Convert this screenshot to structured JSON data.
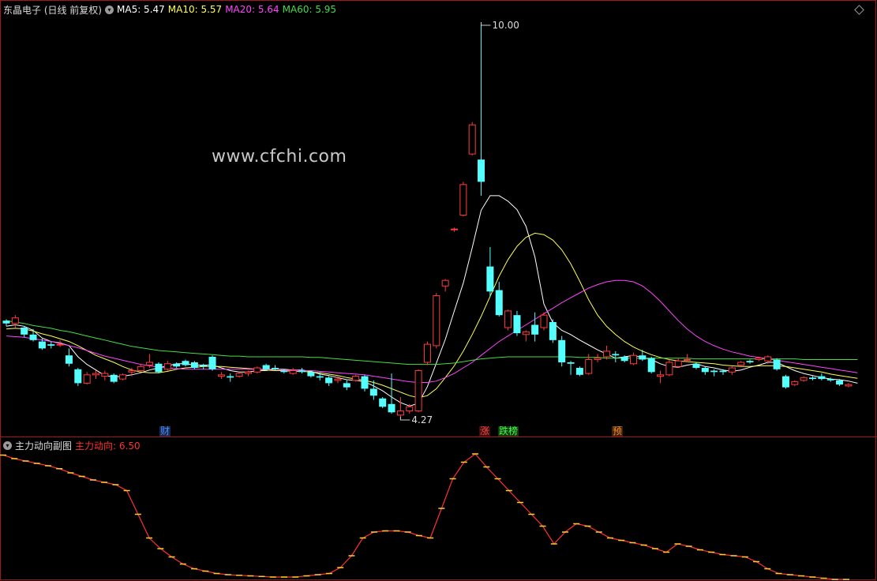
{
  "main_panel": {
    "title": "东晶电子 (日线 前复权)",
    "indicators": [
      {
        "label": "MA5: 5.47",
        "color": "#ffffff"
      },
      {
        "label": "MA10: 5.57",
        "color": "#ffff54"
      },
      {
        "label": "MA20: 5.64",
        "color": "#ff44ff"
      },
      {
        "label": "MA60: 5.95",
        "color": "#44dd44"
      }
    ],
    "high_label": "10.00",
    "low_label": "4.27",
    "watermark": "www.cfchi.com",
    "event_markers": [
      {
        "text": "财",
        "color": "#4488ff",
        "bg": "#1a2a4a"
      },
      {
        "text": "涨",
        "color": "#ff4444",
        "bg": "#3a1010"
      },
      {
        "text": "跌榜",
        "color": "#44ff44",
        "bg": "#103a10"
      },
      {
        "text": "预",
        "color": "#ff8c1a",
        "bg": "#3a2210"
      }
    ]
  },
  "sub_panel": {
    "title": "主力动向副图",
    "indicator_label": "主力动向: 6.50",
    "indicator_color": "#ff3030"
  },
  "chart_data": {
    "type": "candlestick",
    "up_color": "#ff3b3b",
    "down_color": "#54ffff",
    "candles": [
      [
        5.7,
        5.72,
        5.62,
        5.66
      ],
      [
        5.66,
        5.78,
        5.6,
        5.74
      ],
      [
        5.6,
        5.62,
        5.46,
        5.5
      ],
      [
        5.5,
        5.58,
        5.4,
        5.42
      ],
      [
        5.4,
        5.44,
        5.28,
        5.3
      ],
      [
        5.36,
        5.4,
        5.3,
        5.34
      ],
      [
        5.36,
        5.42,
        5.32,
        5.36
      ],
      [
        5.2,
        5.3,
        5.04,
        5.08
      ],
      [
        5.0,
        5.02,
        4.76,
        4.8
      ],
      [
        4.8,
        4.96,
        4.78,
        4.92
      ],
      [
        4.92,
        4.98,
        4.86,
        4.94
      ],
      [
        4.9,
        4.98,
        4.84,
        4.94
      ],
      [
        4.92,
        4.94,
        4.8,
        4.82
      ],
      [
        4.86,
        4.94,
        4.84,
        4.92
      ],
      [
        4.96,
        5.02,
        4.9,
        4.98
      ],
      [
        4.98,
        5.08,
        4.96,
        5.04
      ],
      [
        5.06,
        5.22,
        5.02,
        5.1
      ],
      [
        5.08,
        5.1,
        4.94,
        4.96
      ],
      [
        5.0,
        5.12,
        4.98,
        5.08
      ],
      [
        5.08,
        5.1,
        5.02,
        5.04
      ],
      [
        5.12,
        5.14,
        5.04,
        5.06
      ],
      [
        5.1,
        5.12,
        5.0,
        5.02
      ],
      [
        5.06,
        5.08,
        5.0,
        5.04
      ],
      [
        5.18,
        5.2,
        4.98,
        5.0
      ],
      [
        4.9,
        4.96,
        4.86,
        4.92
      ],
      [
        4.9,
        4.94,
        4.82,
        4.88
      ],
      [
        4.9,
        4.96,
        4.88,
        4.94
      ],
      [
        4.94,
        4.98,
        4.9,
        4.96
      ],
      [
        4.96,
        5.04,
        4.94,
        5.02
      ],
      [
        5.06,
        5.08,
        4.98,
        5.0
      ],
      [
        5.02,
        5.06,
        4.98,
        5.0
      ],
      [
        4.98,
        5.0,
        4.94,
        4.96
      ],
      [
        4.94,
        5.02,
        4.92,
        4.98
      ],
      [
        4.98,
        5.02,
        4.94,
        4.96
      ],
      [
        4.96,
        4.98,
        4.88,
        4.9
      ],
      [
        4.9,
        4.96,
        4.84,
        4.88
      ],
      [
        4.88,
        4.9,
        4.76,
        4.8
      ],
      [
        4.84,
        4.9,
        4.8,
        4.86
      ],
      [
        4.8,
        4.84,
        4.7,
        4.74
      ],
      [
        4.84,
        4.92,
        4.82,
        4.9
      ],
      [
        4.9,
        4.92,
        4.68,
        4.72
      ],
      [
        4.72,
        4.84,
        4.56,
        4.62
      ],
      [
        4.58,
        4.6,
        4.44,
        4.46
      ],
      [
        4.5,
        4.94,
        4.36,
        4.38
      ],
      [
        4.34,
        4.6,
        4.27,
        4.4
      ],
      [
        4.4,
        4.5,
        4.36,
        4.46
      ],
      [
        4.4,
        5.0,
        4.38,
        4.98
      ],
      [
        5.1,
        5.4,
        5.06,
        5.36
      ],
      [
        5.34,
        6.1,
        5.3,
        6.06
      ],
      [
        6.2,
        6.3,
        6.12,
        6.28
      ],
      [
        7.02,
        7.04,
        6.98,
        7.02
      ],
      [
        7.22,
        7.7,
        7.2,
        7.66
      ],
      [
        8.1,
        8.56,
        8.08,
        8.52
      ],
      [
        8.02,
        10.0,
        7.5,
        7.7
      ],
      [
        6.48,
        6.76,
        6.04,
        6.12
      ],
      [
        6.14,
        6.26,
        5.76,
        5.78
      ],
      [
        5.6,
        5.86,
        5.56,
        5.84
      ],
      [
        5.78,
        5.84,
        5.48,
        5.52
      ],
      [
        5.5,
        5.56,
        5.4,
        5.54
      ],
      [
        5.64,
        5.82,
        5.4,
        5.5
      ],
      [
        5.6,
        5.82,
        5.56,
        5.78
      ],
      [
        5.68,
        5.72,
        5.38,
        5.42
      ],
      [
        5.42,
        5.48,
        5.04,
        5.1
      ],
      [
        5.1,
        5.12,
        4.92,
        5.08
      ],
      [
        5.02,
        5.04,
        4.9,
        4.92
      ],
      [
        4.94,
        5.22,
        4.92,
        5.14
      ],
      [
        5.14,
        5.22,
        5.1,
        5.16
      ],
      [
        5.18,
        5.34,
        5.14,
        5.26
      ],
      [
        5.22,
        5.26,
        5.1,
        5.2
      ],
      [
        5.18,
        5.2,
        5.1,
        5.12
      ],
      [
        5.08,
        5.24,
        5.06,
        5.2
      ],
      [
        5.2,
        5.28,
        5.12,
        5.14
      ],
      [
        5.16,
        5.18,
        4.94,
        4.96
      ],
      [
        4.9,
        4.98,
        4.8,
        4.92
      ],
      [
        4.92,
        5.14,
        4.9,
        5.1
      ],
      [
        5.04,
        5.16,
        5.02,
        5.12
      ],
      [
        5.14,
        5.22,
        5.1,
        5.14
      ],
      [
        5.08,
        5.1,
        5.0,
        5.02
      ],
      [
        5.02,
        5.04,
        4.92,
        4.96
      ],
      [
        4.98,
        5.0,
        4.9,
        4.96
      ],
      [
        4.98,
        5.0,
        4.92,
        4.96
      ],
      [
        4.96,
        5.04,
        4.92,
        5.02
      ],
      [
        5.06,
        5.12,
        5.04,
        5.1
      ],
      [
        5.12,
        5.14,
        5.08,
        5.1
      ],
      [
        5.14,
        5.18,
        5.12,
        5.16
      ],
      [
        5.12,
        5.2,
        5.08,
        5.18
      ],
      [
        5.14,
        5.16,
        4.98,
        5.0
      ],
      [
        4.9,
        4.92,
        4.72,
        4.74
      ],
      [
        4.78,
        4.84,
        4.76,
        4.82
      ],
      [
        4.84,
        4.9,
        4.82,
        4.88
      ],
      [
        4.88,
        4.9,
        4.84,
        4.86
      ],
      [
        4.9,
        4.94,
        4.84,
        4.86
      ],
      [
        4.86,
        4.88,
        4.82,
        4.84
      ],
      [
        4.84,
        4.86,
        4.76,
        4.78
      ],
      [
        4.76,
        4.8,
        4.74,
        4.78
      ]
    ],
    "ma_lines": [
      {
        "name": "MA5",
        "color": "#ffffff",
        "values": [
          5.62,
          5.64,
          5.62,
          5.56,
          5.45,
          5.4,
          5.38,
          5.34,
          5.18,
          5.07,
          4.99,
          4.91,
          4.89,
          4.9,
          4.92,
          4.95,
          4.99,
          5.02,
          5.05,
          5.08,
          5.08,
          5.06,
          5.06,
          5.06,
          5.02,
          4.98,
          4.96,
          4.96,
          4.98,
          4.98,
          5.0,
          5.0,
          4.99,
          4.99,
          4.97,
          4.93,
          4.91,
          4.88,
          4.85,
          4.84,
          4.82,
          4.76,
          4.69,
          4.6,
          4.52,
          4.47,
          4.51,
          4.75,
          5.09,
          5.43,
          5.84,
          6.24,
          6.75,
          7.29,
          7.5,
          7.5,
          7.42,
          7.3,
          7.06,
          6.62,
          5.94,
          5.67,
          5.56,
          5.5,
          5.42,
          5.35,
          5.28,
          5.22,
          5.16,
          5.18,
          5.2,
          5.17,
          5.14,
          5.08,
          5.04,
          5.03,
          5.06,
          5.08,
          5.04,
          5.02,
          4.99,
          4.97,
          4.99,
          5.03,
          5.06,
          5.1,
          5.1,
          5.04,
          4.98,
          4.94,
          4.91,
          4.88,
          4.86,
          4.85,
          4.83,
          4.8
        ]
      },
      {
        "name": "MA10",
        "color": "#ffff54",
        "values": [
          5.58,
          5.59,
          5.58,
          5.55,
          5.51,
          5.48,
          5.44,
          5.4,
          5.34,
          5.27,
          5.2,
          5.15,
          5.1,
          5.04,
          4.99,
          4.96,
          4.95,
          4.95,
          4.97,
          5.0,
          5.02,
          5.03,
          5.04,
          5.04,
          5.04,
          5.03,
          5.02,
          5.01,
          5.0,
          4.99,
          4.98,
          4.98,
          4.97,
          4.97,
          4.96,
          4.95,
          4.93,
          4.91,
          4.88,
          4.86,
          4.84,
          4.81,
          4.77,
          4.72,
          4.67,
          4.62,
          4.59,
          4.62,
          4.72,
          4.88,
          5.05,
          5.26,
          5.5,
          5.76,
          6.05,
          6.34,
          6.58,
          6.77,
          6.9,
          6.96,
          6.94,
          6.86,
          6.72,
          6.52,
          6.27,
          6.0,
          5.78,
          5.62,
          5.5,
          5.4,
          5.32,
          5.26,
          5.21,
          5.17,
          5.14,
          5.12,
          5.11,
          5.1,
          5.09,
          5.08,
          5.06,
          5.05,
          5.04,
          5.04,
          5.05,
          5.05,
          5.05,
          5.04,
          5.02,
          5.0,
          4.98,
          4.96,
          4.93,
          4.91,
          4.89,
          4.87
        ]
      },
      {
        "name": "MA20",
        "color": "#ff44ff",
        "values": [
          5.48,
          5.47,
          5.46,
          5.44,
          5.42,
          5.4,
          5.37,
          5.34,
          5.31,
          5.27,
          5.23,
          5.19,
          5.16,
          5.13,
          5.1,
          5.07,
          5.05,
          5.03,
          5.02,
          5.01,
          5.0,
          5.0,
          5.0,
          5.0,
          5.0,
          5.0,
          5.0,
          5.0,
          5.0,
          5.0,
          5.0,
          4.99,
          4.99,
          4.98,
          4.98,
          4.97,
          4.96,
          4.95,
          4.94,
          4.93,
          4.92,
          4.9,
          4.88,
          4.86,
          4.84,
          4.82,
          4.81,
          4.81,
          4.83,
          4.88,
          4.94,
          5.02,
          5.1,
          5.2,
          5.3,
          5.4,
          5.48,
          5.56,
          5.64,
          5.72,
          5.8,
          5.88,
          5.96,
          6.03,
          6.1,
          6.17,
          6.22,
          6.26,
          6.28,
          6.28,
          6.26,
          6.2,
          6.1,
          5.98,
          5.84,
          5.7,
          5.58,
          5.48,
          5.4,
          5.34,
          5.29,
          5.25,
          5.22,
          5.19,
          5.17,
          5.15,
          5.13,
          5.11,
          5.09,
          5.07,
          5.05,
          5.03,
          5.01,
          4.99,
          4.97,
          4.95
        ]
      },
      {
        "name": "MA60",
        "color": "#44dd44",
        "values": [
          5.7,
          5.68,
          5.66,
          5.63,
          5.61,
          5.59,
          5.56,
          5.54,
          5.51,
          5.48,
          5.45,
          5.42,
          5.39,
          5.36,
          5.33,
          5.31,
          5.29,
          5.27,
          5.26,
          5.25,
          5.24,
          5.23,
          5.22,
          5.21,
          5.2,
          5.19,
          5.19,
          5.18,
          5.18,
          5.18,
          5.18,
          5.18,
          5.18,
          5.18,
          5.17,
          5.17,
          5.16,
          5.15,
          5.14,
          5.13,
          5.12,
          5.11,
          5.1,
          5.09,
          5.08,
          5.07,
          5.07,
          5.07,
          5.07,
          5.08,
          5.09,
          5.11,
          5.13,
          5.15,
          5.16,
          5.17,
          5.18,
          5.18,
          5.18,
          5.18,
          5.18,
          5.18,
          5.18,
          5.18,
          5.17,
          5.17,
          5.17,
          5.16,
          5.16,
          5.16,
          5.16,
          5.16,
          5.16,
          5.16,
          5.16,
          5.16,
          5.16,
          5.15,
          5.15,
          5.15,
          5.15,
          5.15,
          5.15,
          5.15,
          5.15,
          5.15,
          5.15,
          5.15,
          5.15,
          5.14,
          5.14,
          5.14,
          5.14,
          5.14,
          5.14,
          5.14
        ]
      }
    ],
    "sub_series": {
      "name": "主力动向",
      "color": "#ff3030",
      "values": [
        5.8,
        5.74,
        5.7,
        5.66,
        5.62,
        5.57,
        5.5,
        5.44,
        5.38,
        5.34,
        5.3,
        5.2,
        4.8,
        4.4,
        4.22,
        4.08,
        3.96,
        3.88,
        3.84,
        3.8,
        3.78,
        3.77,
        3.76,
        3.75,
        3.74,
        3.74,
        3.74,
        3.76,
        3.78,
        3.8,
        3.9,
        4.1,
        4.4,
        4.5,
        4.52,
        4.52,
        4.5,
        4.44,
        4.4,
        4.9,
        5.4,
        5.68,
        5.82,
        5.6,
        5.4,
        5.2,
        5.0,
        4.8,
        4.6,
        4.3,
        4.5,
        4.64,
        4.6,
        4.5,
        4.4,
        4.36,
        4.32,
        4.28,
        4.22,
        4.16,
        4.3,
        4.26,
        4.2,
        4.16,
        4.12,
        4.1,
        4.08,
        4.0,
        3.88,
        3.8,
        3.78,
        3.76,
        3.74,
        3.72,
        3.7,
        3.7
      ]
    }
  }
}
